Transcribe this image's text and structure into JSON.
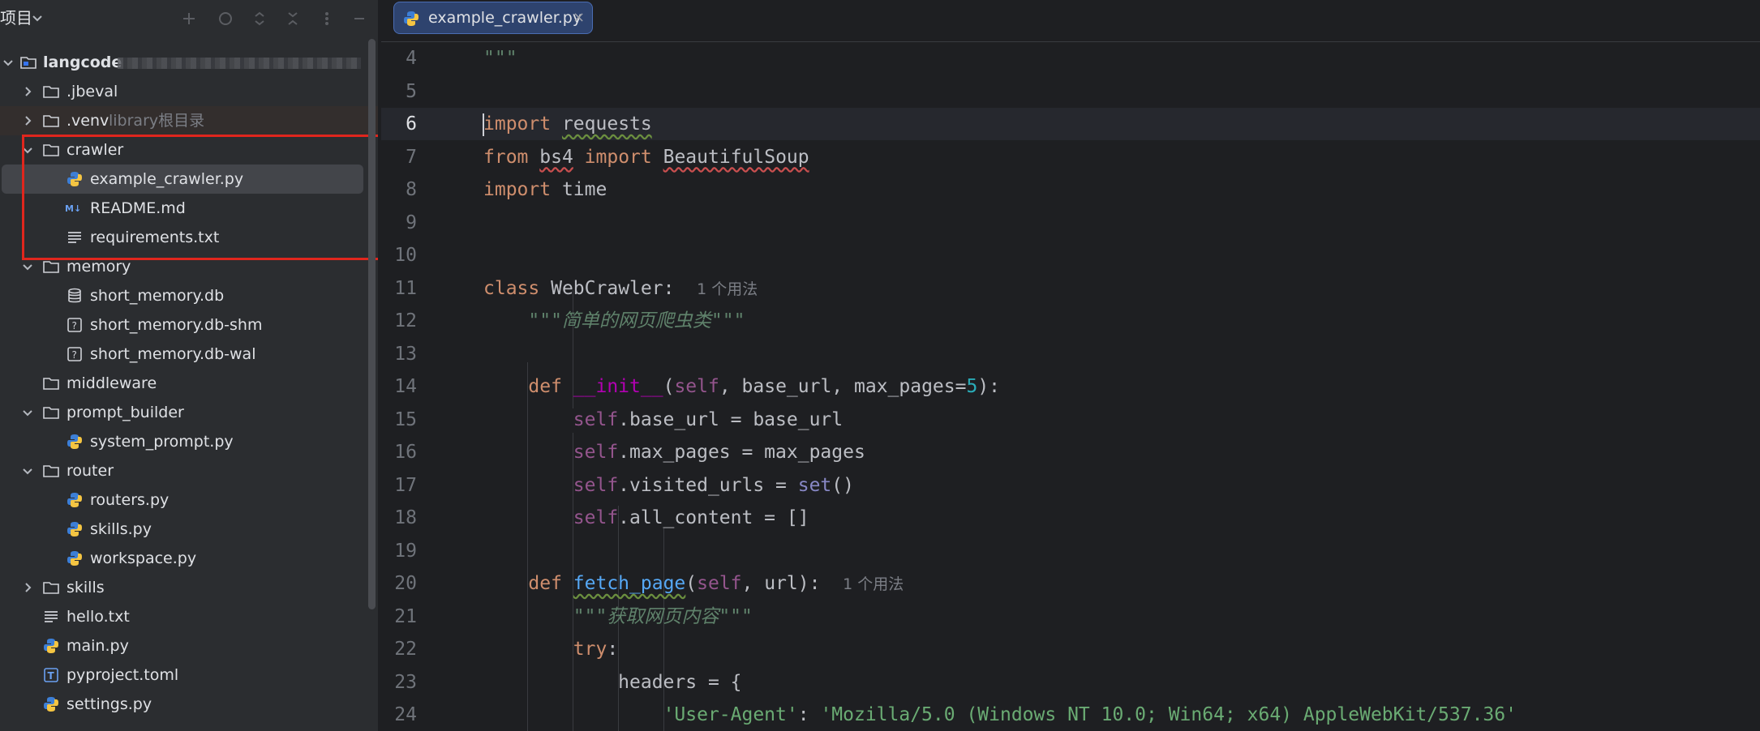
{
  "project_panel": {
    "title": "项目",
    "root": {
      "label": "langcode"
    },
    "items": [
      {
        "label": ".jbeval"
      },
      {
        "label": ".venv",
        "hint": "library根目录"
      },
      {
        "label": "crawler"
      },
      {
        "label": "example_crawler.py"
      },
      {
        "label": "README.md"
      },
      {
        "label": "requirements.txt"
      },
      {
        "label": "memory"
      },
      {
        "label": "short_memory.db"
      },
      {
        "label": "short_memory.db-shm"
      },
      {
        "label": "short_memory.db-wal"
      },
      {
        "label": "middleware"
      },
      {
        "label": "prompt_builder"
      },
      {
        "label": "system_prompt.py"
      },
      {
        "label": "router"
      },
      {
        "label": "routers.py"
      },
      {
        "label": "skills.py"
      },
      {
        "label": "workspace.py"
      },
      {
        "label": "skills"
      },
      {
        "label": "hello.txt"
      },
      {
        "label": "main.py"
      },
      {
        "label": "pyproject.toml"
      },
      {
        "label": "settings.py"
      }
    ]
  },
  "editor": {
    "tab": {
      "label": "example_crawler.py",
      "close": "×"
    },
    "current_line": "6",
    "lines": [
      {
        "n": "4"
      },
      {
        "n": "5"
      },
      {
        "n": "6"
      },
      {
        "n": "7"
      },
      {
        "n": "8"
      },
      {
        "n": "9"
      },
      {
        "n": "10"
      },
      {
        "n": "11"
      },
      {
        "n": "12"
      },
      {
        "n": "13"
      },
      {
        "n": "14"
      },
      {
        "n": "15"
      },
      {
        "n": "16"
      },
      {
        "n": "17"
      },
      {
        "n": "18"
      },
      {
        "n": "19"
      },
      {
        "n": "20"
      },
      {
        "n": "21"
      },
      {
        "n": "22"
      },
      {
        "n": "23"
      },
      {
        "n": "24"
      }
    ],
    "code": {
      "l4_doc": "\"\"\"",
      "l6_kw": "import",
      "l6_mod": "requests",
      "l7_kw1": "from",
      "l7_mod": "bs4",
      "l7_kw2": "import",
      "l7_name": "BeautifulSoup",
      "l8_kw": "import",
      "l8_mod": "time",
      "l11_kw": "class",
      "l11_name": "WebCrawler:",
      "l11_hint": "1 个用法",
      "l12_doc": "\"\"\"简单的网页爬虫类\"\"\"",
      "l14_kw": "def",
      "l14_fn": "__init__",
      "l14_p1": "(",
      "l14_self": "self",
      "l14_p2": ", base_url, max_pages=",
      "l14_num": "5",
      "l14_p3": "):",
      "l15_self": "self",
      "l15_rest": ".base_url = base_url",
      "l16_self": "self",
      "l16_rest": ".max_pages = max_pages",
      "l17_self": "self",
      "l17_rest": ".visited_urls = ",
      "l17_bi": "set",
      "l17_end": "()",
      "l18_self": "self",
      "l18_rest": ".all_content = []",
      "l20_kw": "def",
      "l20_fn": "fetch_page",
      "l20_p1": "(",
      "l20_self": "self",
      "l20_p2": ", url):",
      "l20_hint": "1 个用法",
      "l21_doc": "\"\"\"获取网页内容\"\"\"",
      "l22_kw": "try",
      "l22_colon": ":",
      "l23_code": "headers = {",
      "l24_key": "'User-Agent'",
      "l24_colon": ": ",
      "l24_val": "'Mozilla/5.0 (Windows NT 10.0; Win64; x64) AppleWebKit/537.36'"
    }
  },
  "colors": {
    "accent": "#3574f0",
    "highlight_box": "#e0261d",
    "selection": "#43454a"
  }
}
